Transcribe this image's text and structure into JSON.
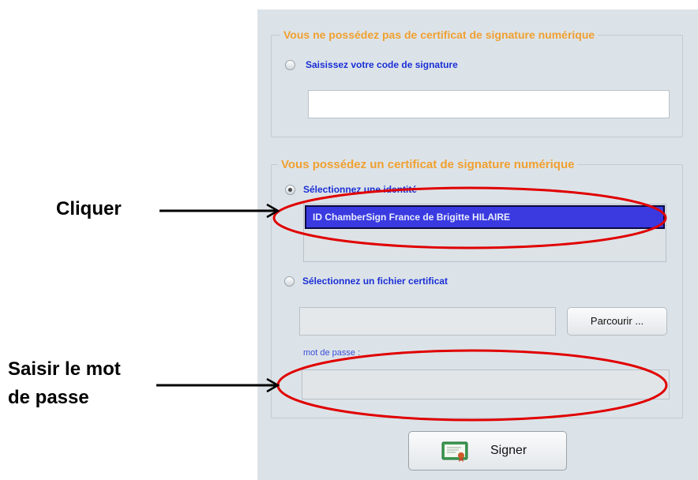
{
  "certificate_panel": {
    "section_no_cert": {
      "legend": "Vous ne possédez pas de certificat de signature numérique",
      "radio_code_label": "Saisissez votre code de signature",
      "code_input_value": ""
    },
    "section_cert": {
      "legend": "Vous possédez un certificat de signature numérique",
      "radio_identity_label": "Sélectionnez une identité",
      "radio_identity_checked": true,
      "identity_list": [
        "ID ChamberSign France de Brigitte HILAIRE"
      ],
      "radio_file_label": "Sélectionnez un fichier certificat",
      "file_input_value": "",
      "browse_button_label": "Parcourir ...",
      "password_label": "mot de passe :",
      "password_value": ""
    },
    "sign_button_label": "Signer"
  },
  "annotations": {
    "click_label": "Cliquer",
    "password_line1": "Saisir le mot",
    "password_line2": "de passe",
    "highlight_color": "#e00000"
  },
  "icons": {
    "sign_button_icon": "certificate-icon"
  }
}
